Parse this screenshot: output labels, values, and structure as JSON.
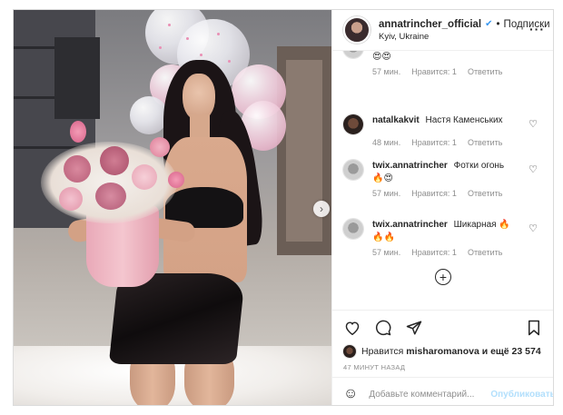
{
  "post": {
    "username": "annatrincher_official",
    "verified_icon": "verified-badge-icon",
    "follow_label": "Подписки",
    "location": "Kyiv, Ukraine",
    "more_icon": "more-options-icon"
  },
  "comments": [
    {
      "username": "",
      "text": "",
      "emoji": "😍😍",
      "time": "57 мин.",
      "likes": "Нравится: 1",
      "reply": "Ответить"
    },
    {
      "username": "natalkakvit",
      "text": "Настя Каменських",
      "emoji": "",
      "time": "48 мин.",
      "likes": "Нравится: 1",
      "reply": "Ответить"
    },
    {
      "username": "twix.annatrincher",
      "text": "Фотки огонь",
      "emoji": "🔥😍",
      "time": "57 мин.",
      "likes": "Нравится: 1",
      "reply": "Ответить"
    },
    {
      "username": "twix.annatrincher",
      "text": "Шикарная 🔥",
      "emoji": "🔥🔥",
      "time": "57 мин.",
      "likes": "Нравится: 1",
      "reply": "Ответить"
    }
  ],
  "actions": {
    "likes_prefix": "Нравится",
    "liked_by": "misharomanova",
    "likes_suffix": "и ещё 23 574",
    "timestamp": "47 МИНУТ НАЗАД"
  },
  "comment_box": {
    "placeholder": "Добавьте комментарий...",
    "publish_label": "Опубликовать"
  },
  "colors": {
    "accent_blue": "#3897f0",
    "publish_disabled": "#b2dffc",
    "text_muted": "#8e8e8e"
  }
}
